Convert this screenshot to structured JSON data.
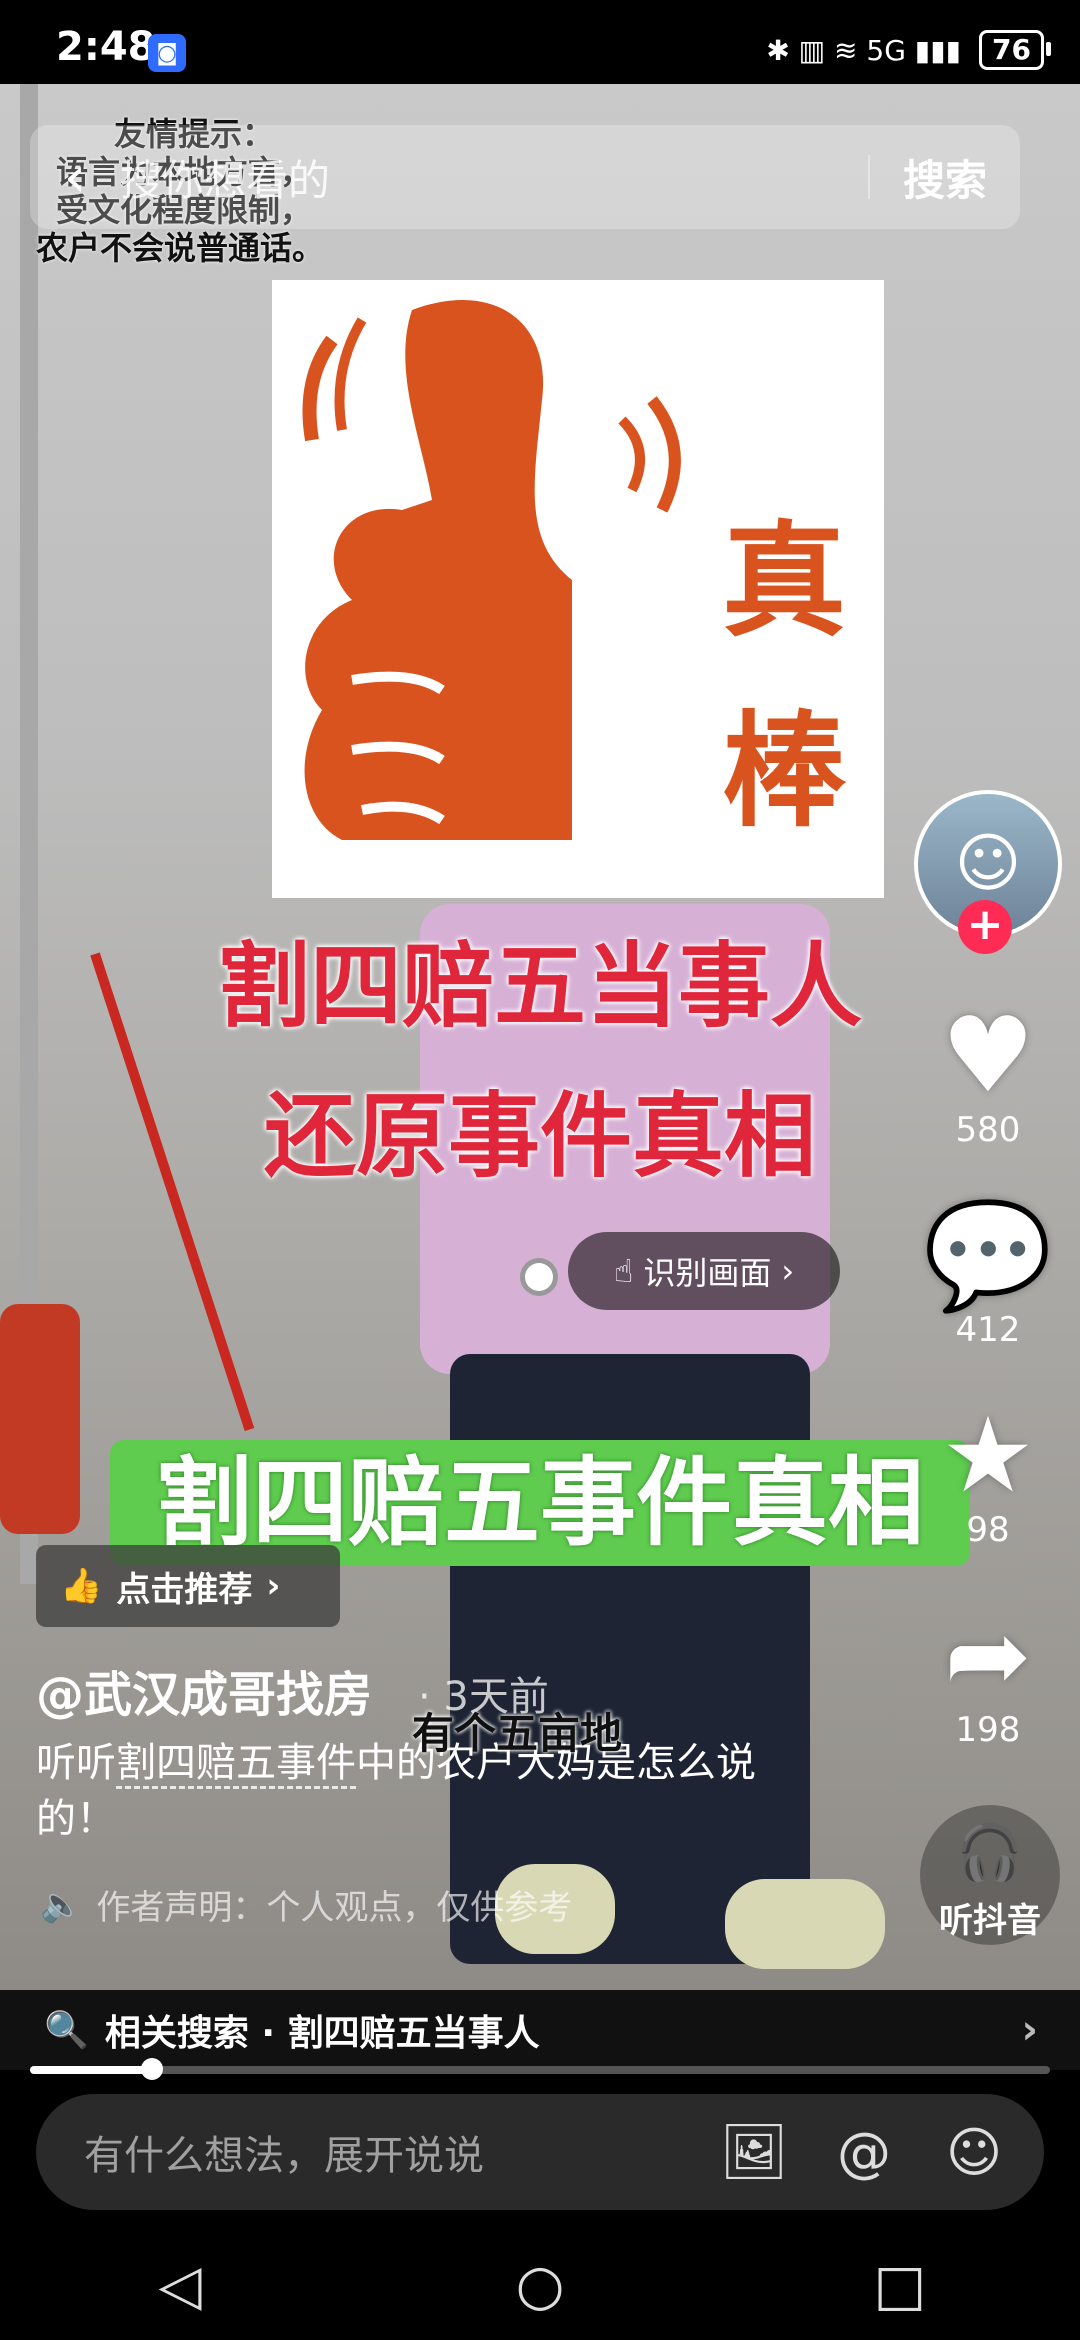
{
  "status_bar": {
    "time": "2:48",
    "app_badge": "◙",
    "icons": "✱ ▥ ≋ 5G ▮▮▮",
    "battery": "76"
  },
  "search": {
    "placeholder": "搜你想看的",
    "button": "搜索"
  },
  "video": {
    "notice_lines": [
      "友情提示：",
      "语言为本地方言，",
      "受文化程度限制，",
      "农户不会说普通话。"
    ],
    "card_chars": [
      "真",
      "棒"
    ],
    "title_line1": "割四赔五当事人",
    "title_line2": "还原事件真相",
    "recognize_label": "识别画面",
    "green_banner": "割四赔五事件真相",
    "subtitle": "有个五亩地"
  },
  "rail": {
    "like_count": "580",
    "comment_count": "412",
    "favorite_count": "98",
    "share_count": "198",
    "listen_label": "听抖音"
  },
  "post": {
    "recommend_label": "点击推荐",
    "author": "@武汉成哥找房",
    "time_ago": "· 3天前",
    "desc_prefix": "听听",
    "desc_keyword": "割四赔五事件",
    "desc_suffix": "中的农户大妈是怎么说的！",
    "declaration": "作者声明：个人观点，仅供参考"
  },
  "related": {
    "label": "相关搜索 · 割四赔五当事人"
  },
  "progress": {
    "fraction": 0.12
  },
  "comment": {
    "placeholder": "有什么想法，展开说说"
  },
  "icons": {
    "back": "back-icon",
    "heart": "heart-icon",
    "comment": "comment-icon",
    "star": "star-icon",
    "share": "share-icon",
    "headphones": "headphones-icon",
    "image": "image-icon",
    "at": "at-icon",
    "emoji": "emoji-icon"
  },
  "colors": {
    "follow_red": "#fe2c55",
    "title_red": "#e0263a",
    "banner_green": "#5fcc4f",
    "card_orange": "#d9531e"
  }
}
